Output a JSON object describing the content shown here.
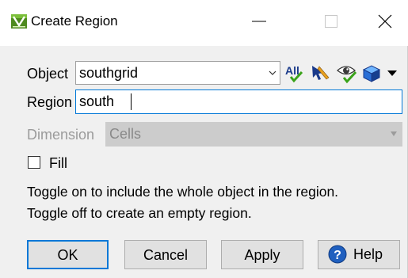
{
  "window": {
    "title": "Create Region",
    "minimize_glyph": "—",
    "maximize_glyph": "☐",
    "close_glyph": "✕"
  },
  "object_row": {
    "label": "Object",
    "value": "southgrid",
    "all_button_label": "All",
    "icons": [
      "all-objects-icon",
      "pick-object-icon",
      "visible-objects-icon",
      "3d-cube-icon",
      "dropdown-arrow-icon"
    ]
  },
  "region_row": {
    "label": "Region",
    "value": "south"
  },
  "dimension_row": {
    "label": "Dimension",
    "value": "Cells",
    "enabled": false
  },
  "fill": {
    "label": "Fill",
    "checked": false
  },
  "help_text": {
    "line1": "Toggle on to include the whole object in the region.",
    "line2": "Toggle off to create an empty region."
  },
  "buttons": {
    "ok": "OK",
    "cancel": "Cancel",
    "apply": "Apply",
    "help": "Help"
  },
  "colors": {
    "focus_border": "#0078d7",
    "window_background": "#f0f0f0",
    "help_icon_blue": "#1f5fbf"
  }
}
